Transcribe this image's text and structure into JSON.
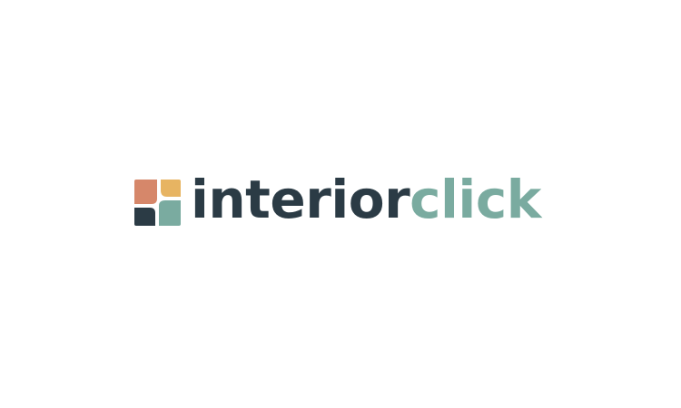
{
  "logo": {
    "word_primary": "interior",
    "word_secondary": "click",
    "colors": {
      "dark": "#2b3b45",
      "teal": "#7aaba0",
      "terracotta": "#d6876a",
      "mustard": "#e7b462",
      "background": "#ffffff"
    },
    "mark_icon": "four-tile-square-icon"
  }
}
